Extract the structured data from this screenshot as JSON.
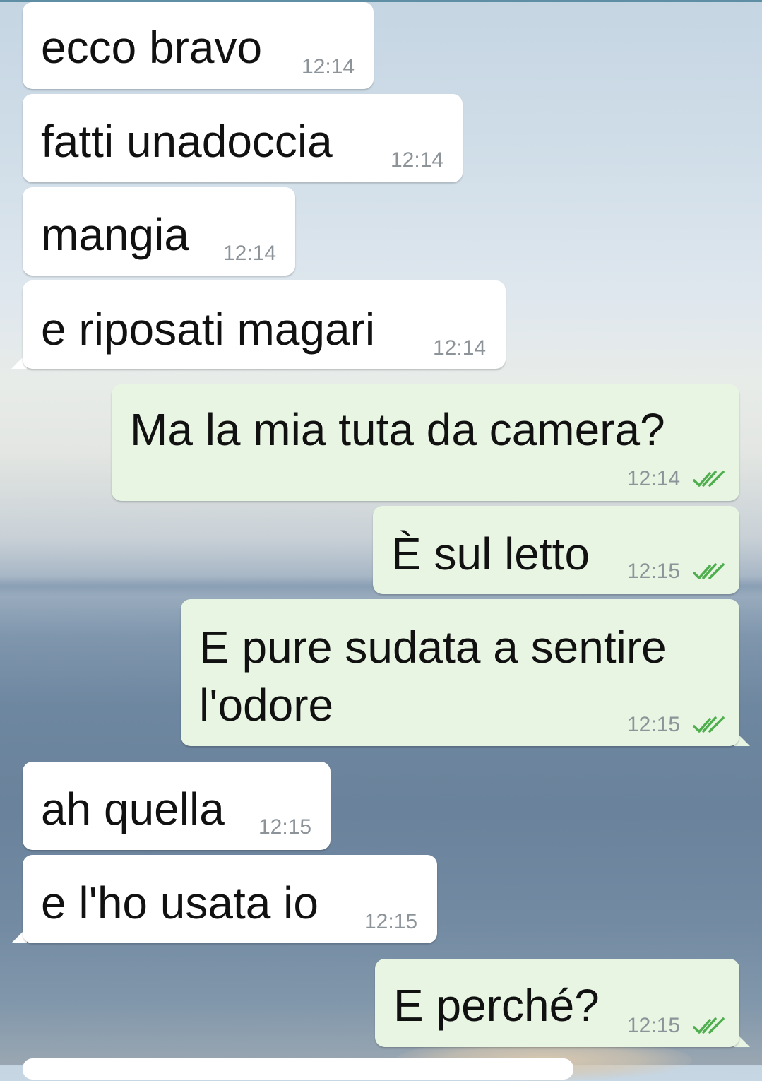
{
  "messages": [
    {
      "text": "ecco bravo",
      "time": "12:14",
      "direction": "incoming"
    },
    {
      "text": "fatti unadoccia",
      "time": "12:14",
      "direction": "incoming"
    },
    {
      "text": "mangia",
      "time": "12:14",
      "direction": "incoming"
    },
    {
      "text": "e riposati magari",
      "time": "12:14",
      "direction": "incoming"
    },
    {
      "text": "Ma la mia tuta da camera?",
      "time": "12:14",
      "direction": "outgoing",
      "status": "read-ticks"
    },
    {
      "text": "È sul letto",
      "time": "12:15",
      "direction": "outgoing",
      "status": "read-ticks"
    },
    {
      "text_line1": "E pure sudata a sentire",
      "text_line2": "l'odore",
      "time": "12:15",
      "direction": "outgoing",
      "status": "read-ticks"
    },
    {
      "text": "ah quella",
      "time": "12:15",
      "direction": "incoming"
    },
    {
      "text": "e l'ho usata io",
      "time": "12:15",
      "direction": "incoming"
    },
    {
      "text": "E perché?",
      "time": "12:15",
      "direction": "outgoing",
      "status": "read-ticks"
    }
  ],
  "colors": {
    "incoming_bubble": "#ffffff",
    "outgoing_bubble": "#e8f5e3",
    "read_ticks": "#4fae4e",
    "timestamp": "#8c9399"
  },
  "icons": {
    "read_status": "double-check-icon"
  }
}
